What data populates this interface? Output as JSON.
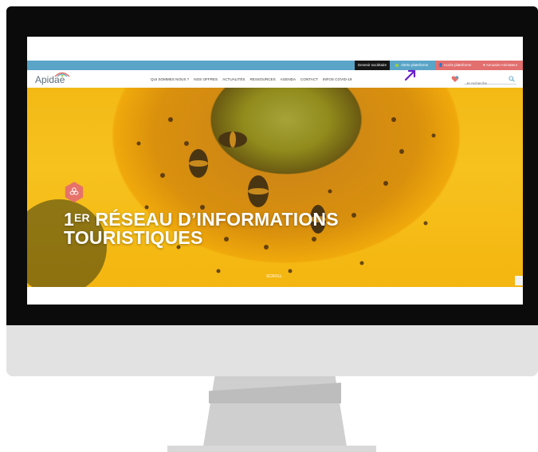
{
  "topbar": {
    "become_member": "Devenir sociétaire",
    "platform_alert": "Alerte plateforme",
    "platform_access": "Accès plateforme",
    "annuaire": "Annuaire Animateur"
  },
  "header": {
    "logo_text": "Apidae",
    "nav_items": [
      "QUI SOMMES NOUS ?",
      "NOS OFFRES",
      "ACTUALITÉS",
      "RESSOURCES",
      "AGENDA",
      "CONTACT",
      "INFOS COVID-19"
    ],
    "search_placeholder": "Je recherche"
  },
  "hero": {
    "title_sup": "ER",
    "title_line1_num": "1",
    "title_line1_rest": " RÉSEAU D’INFORMATIONS",
    "title_line2": "TOURISTIQUES",
    "scroll_label": "SCROLL"
  },
  "colors": {
    "topbar": "#5aa4c7",
    "accent_red": "#e26e6e",
    "badge": "#e6726a",
    "arrow": "#6a1fd0"
  }
}
